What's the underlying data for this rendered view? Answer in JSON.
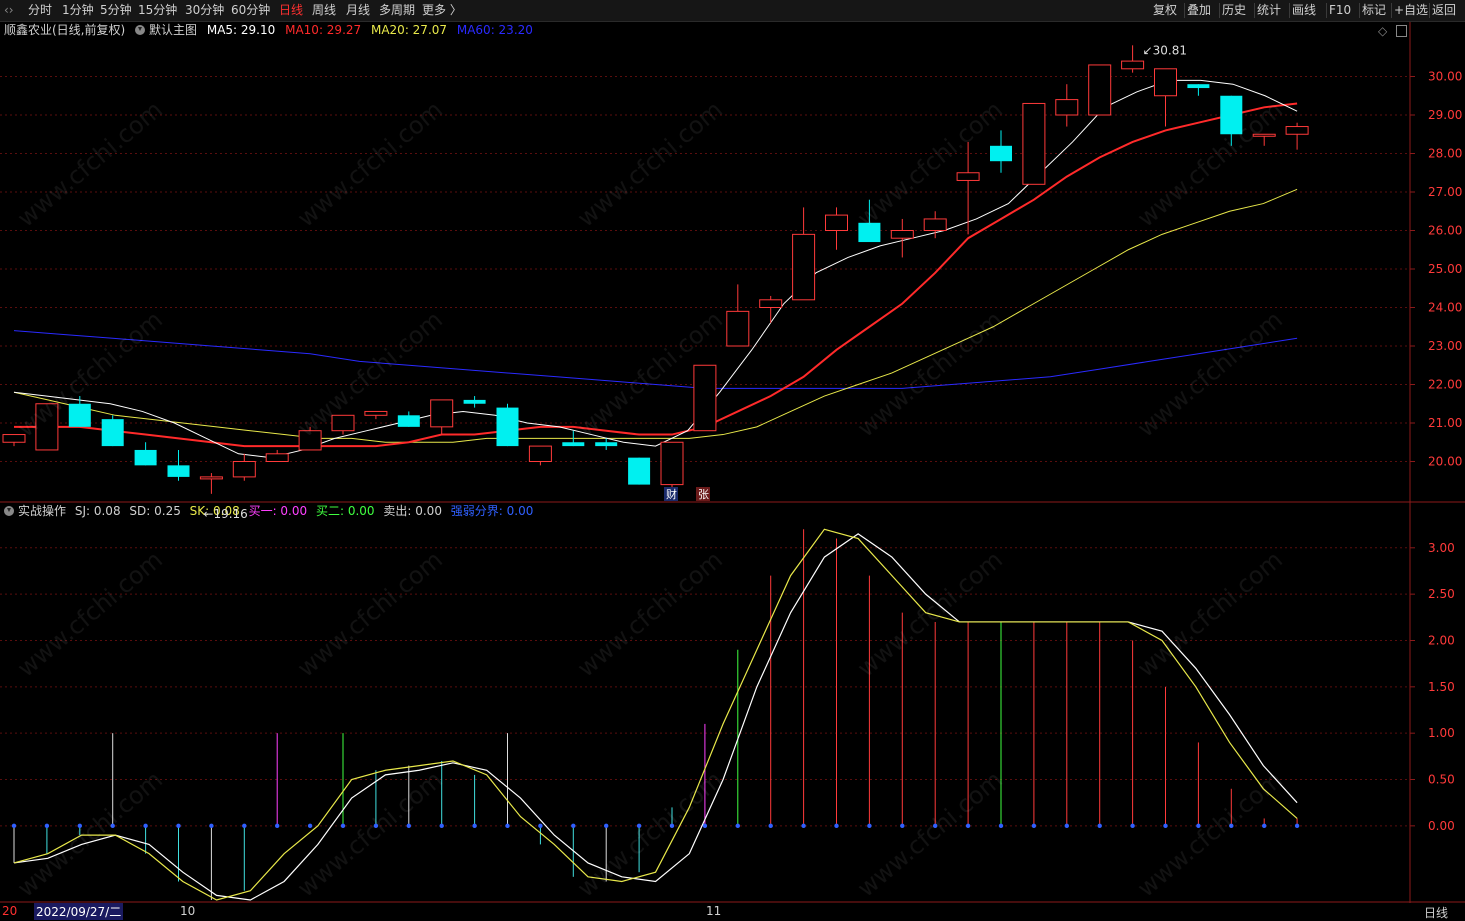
{
  "toolbar": {
    "periods": [
      "分时",
      "1分钟",
      "5分钟",
      "15分钟",
      "30分钟",
      "60分钟",
      "日线",
      "周线",
      "月线",
      "多周期",
      "更多 〉"
    ],
    "active_period": "日线",
    "right_buttons": [
      "复权",
      "叠加",
      "历史",
      "统计",
      "画线",
      "F10",
      "标记",
      "+自选",
      "返回"
    ]
  },
  "main_info": {
    "stock": "顺鑫农业(日线,前复权)",
    "template": "默认主图",
    "ma5": "MA5: 29.10",
    "ma10": "MA10: 29.27",
    "ma20": "MA20: 27.07",
    "ma60": "MA60: 23.20"
  },
  "sub_info": {
    "name": "实战操作",
    "sj": "SJ: 0.08",
    "sd": "SD: 0.25",
    "sk": "SK: 0.08",
    "buy1": "买一: 0.00",
    "buy2": "买二: 0.00",
    "sell": "卖出: 0.00",
    "strong_weak": "强弱分界: 0.00"
  },
  "date_axis": {
    "cursor_date": "2022/09/27/二",
    "left_stub": "20",
    "month_10": "10",
    "month_11": "11",
    "period_label": "日线"
  },
  "watermark": "www.cfchi.com",
  "colors": {
    "up": "#ff3a3a",
    "down": "#00f0f0",
    "ma5": "#ffffff",
    "ma10": "#ff2a2a",
    "ma20": "#e8e84a",
    "ma60": "#2a2aff",
    "buy1": "#ff40ff",
    "buy2": "#40ff40",
    "strong": "#3060ff"
  },
  "chart_data": [
    {
      "type": "candlestick",
      "y_ticks": [
        "30.00",
        "29.00",
        "28.00",
        "27.00",
        "26.00",
        "25.00",
        "24.00",
        "23.00",
        "22.00",
        "21.00",
        "20.00"
      ],
      "ylim": [
        19.0,
        31.0
      ],
      "candles": [
        [
          20.5,
          20.7,
          20.4,
          20.7
        ],
        [
          20.3,
          21.5,
          20.3,
          21.5
        ],
        [
          21.5,
          21.7,
          20.9,
          20.9
        ],
        [
          21.1,
          21.2,
          20.4,
          20.4
        ],
        [
          20.3,
          20.5,
          19.9,
          19.9
        ],
        [
          19.9,
          20.3,
          19.5,
          19.6
        ],
        [
          19.6,
          19.7,
          19.16,
          19.6
        ],
        [
          19.6,
          20.2,
          19.5,
          20.0
        ],
        [
          20.0,
          20.3,
          20.0,
          20.2
        ],
        [
          20.3,
          20.9,
          20.3,
          20.8
        ],
        [
          20.8,
          21.2,
          20.7,
          21.2
        ],
        [
          21.2,
          21.3,
          21.1,
          21.3
        ],
        [
          21.2,
          21.3,
          20.9,
          20.9
        ],
        [
          20.9,
          21.6,
          20.7,
          21.6
        ],
        [
          21.6,
          21.7,
          21.4,
          21.5
        ],
        [
          21.4,
          21.5,
          20.4,
          20.4
        ],
        [
          20.0,
          20.4,
          19.9,
          20.4
        ],
        [
          20.5,
          20.8,
          20.4,
          20.4
        ],
        [
          20.5,
          20.6,
          20.3,
          20.4
        ],
        [
          20.1,
          20.1,
          19.4,
          19.4
        ],
        [
          19.4,
          20.5,
          19.3,
          20.5
        ],
        [
          20.8,
          22.5,
          20.8,
          22.5
        ],
        [
          23.0,
          24.6,
          23.0,
          23.9
        ],
        [
          24.0,
          24.3,
          23.6,
          24.2
        ],
        [
          24.2,
          26.6,
          24.2,
          25.9
        ],
        [
          26.0,
          26.6,
          25.5,
          26.4
        ],
        [
          26.2,
          26.8,
          25.8,
          25.7
        ],
        [
          25.8,
          26.3,
          25.3,
          26.0
        ],
        [
          26.0,
          26.5,
          25.8,
          26.3
        ],
        [
          27.3,
          28.3,
          25.9,
          27.5
        ],
        [
          28.2,
          28.6,
          27.5,
          27.8
        ],
        [
          27.2,
          29.2,
          27.2,
          29.3
        ],
        [
          29.0,
          29.8,
          28.7,
          29.4
        ],
        [
          29.0,
          30.3,
          29.0,
          30.3
        ],
        [
          30.2,
          30.81,
          30.1,
          30.4
        ],
        [
          29.5,
          30.2,
          28.7,
          30.2
        ],
        [
          29.8,
          29.8,
          29.5,
          29.7
        ],
        [
          29.5,
          29.5,
          28.2,
          28.5
        ],
        [
          28.5,
          28.5,
          28.2,
          28.5
        ],
        [
          28.5,
          28.8,
          28.1,
          28.7
        ]
      ],
      "ma5": [
        21.8,
        21.7,
        21.6,
        21.5,
        21.3,
        21.0,
        20.6,
        20.2,
        20.1,
        20.3,
        20.6,
        20.8,
        21.0,
        21.2,
        21.3,
        21.2,
        21.0,
        20.9,
        20.7,
        20.5,
        20.4,
        20.8,
        21.8,
        22.9,
        24.1,
        24.9,
        25.3,
        25.6,
        25.8,
        26.0,
        26.3,
        26.7,
        27.5,
        28.3,
        29.2,
        29.6,
        29.9,
        29.9,
        29.8,
        29.5,
        29.1
      ],
      "ma10": [
        20.9,
        20.9,
        20.9,
        20.8,
        20.7,
        20.6,
        20.5,
        20.4,
        20.4,
        20.4,
        20.4,
        20.4,
        20.5,
        20.7,
        20.7,
        20.8,
        20.9,
        20.9,
        20.8,
        20.7,
        20.7,
        20.9,
        21.3,
        21.7,
        22.2,
        22.9,
        23.5,
        24.1,
        24.9,
        25.8,
        26.3,
        26.8,
        27.4,
        27.9,
        28.3,
        28.6,
        28.8,
        29.0,
        29.2,
        29.3
      ],
      "ma20": [
        21.8,
        21.6,
        21.4,
        21.2,
        21.1,
        21.0,
        20.9,
        20.8,
        20.7,
        20.6,
        20.6,
        20.5,
        20.5,
        20.5,
        20.6,
        20.6,
        20.6,
        20.6,
        20.6,
        20.6,
        20.6,
        20.7,
        20.9,
        21.3,
        21.7,
        22.0,
        22.3,
        22.7,
        23.1,
        23.5,
        24.0,
        24.5,
        25.0,
        25.5,
        25.9,
        26.2,
        26.5,
        26.7,
        27.07
      ],
      "ma60": [
        23.4,
        23.3,
        23.2,
        23.1,
        23.0,
        22.9,
        22.8,
        22.6,
        22.5,
        22.4,
        22.3,
        22.2,
        22.1,
        22.0,
        21.9,
        21.9,
        21.9,
        21.9,
        21.9,
        22.0,
        22.1,
        22.2,
        22.4,
        22.6,
        22.8,
        23.0,
        23.2
      ],
      "annotations": {
        "high": "30.81",
        "low": "19.16",
        "badges": [
          "财",
          "张"
        ]
      }
    },
    {
      "type": "line",
      "y_ticks": [
        "3.00",
        "2.50",
        "2.00",
        "1.50",
        "1.00",
        "0.50",
        "0.00"
      ],
      "ylim": [
        -0.8,
        3.3
      ],
      "sk": [
        -0.4,
        -0.3,
        -0.1,
        -0.1,
        -0.3,
        -0.6,
        -0.8,
        -0.7,
        -0.3,
        0.0,
        0.5,
        0.6,
        0.65,
        0.7,
        0.55,
        0.1,
        -0.2,
        -0.55,
        -0.6,
        -0.5,
        0.2,
        1.1,
        1.9,
        2.7,
        3.2,
        3.1,
        2.7,
        2.3,
        2.2,
        2.2,
        2.2,
        2.2,
        2.2,
        2.2,
        2.0,
        1.5,
        0.9,
        0.4,
        0.08
      ],
      "sd": [
        -0.4,
        -0.35,
        -0.2,
        -0.1,
        -0.2,
        -0.5,
        -0.75,
        -0.8,
        -0.6,
        -0.2,
        0.3,
        0.55,
        0.6,
        0.68,
        0.6,
        0.3,
        -0.1,
        -0.4,
        -0.55,
        -0.6,
        -0.3,
        0.5,
        1.5,
        2.3,
        2.9,
        3.15,
        2.9,
        2.5,
        2.2,
        2.2,
        2.2,
        2.2,
        2.2,
        2.2,
        2.1,
        1.7,
        1.2,
        0.65,
        0.25
      ],
      "stems": [
        1,
        1,
        1,
        1,
        1,
        1,
        1,
        1,
        1,
        1,
        1,
        1,
        1,
        1,
        1,
        1,
        1,
        1,
        1,
        1,
        1,
        1,
        1,
        1,
        1,
        1,
        1,
        1,
        1,
        1,
        1,
        1,
        1,
        1,
        1,
        1,
        1,
        1,
        1,
        1
      ]
    }
  ]
}
